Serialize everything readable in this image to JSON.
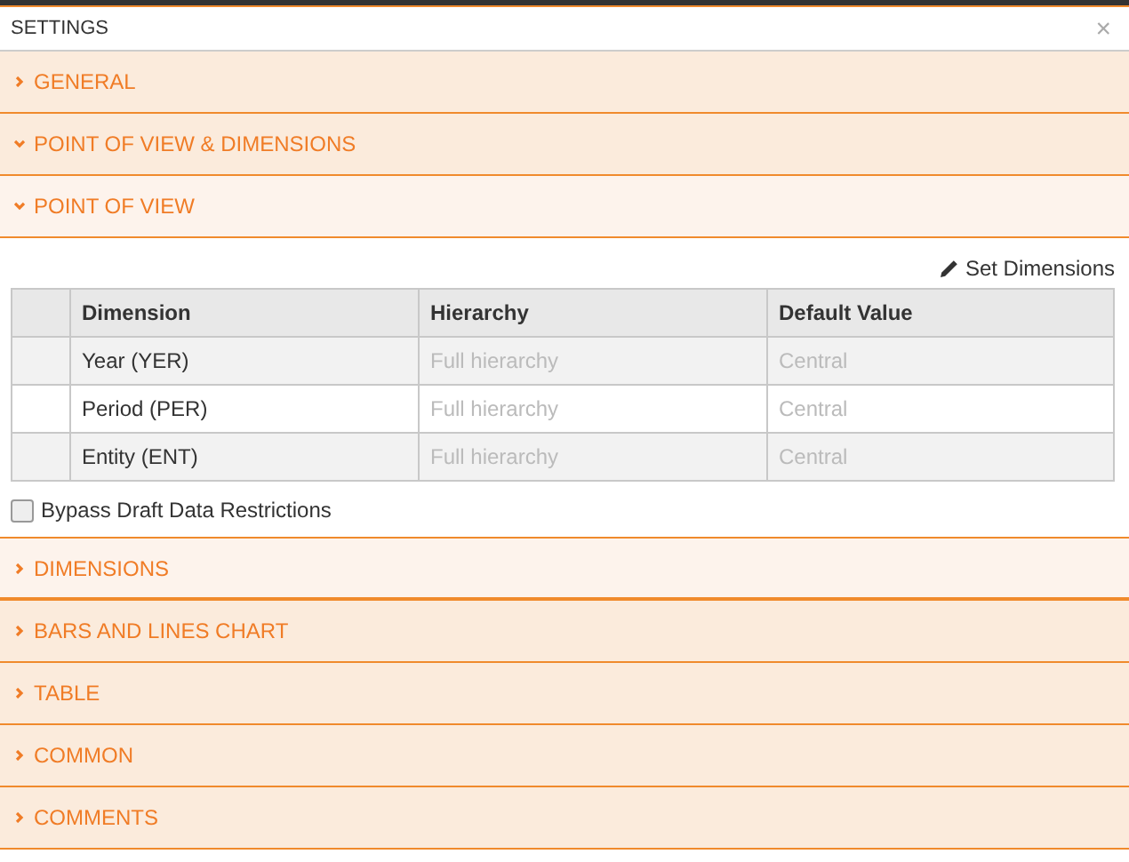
{
  "window": {
    "title": "SETTINGS",
    "close": "×"
  },
  "sections": [
    {
      "label": "GENERAL",
      "expanded": false
    },
    {
      "label": "POINT OF VIEW & DIMENSIONS",
      "expanded": true,
      "children": [
        {
          "label": "POINT OF VIEW",
          "expanded": true,
          "content": {
            "action": "Set Dimensions",
            "columns": [
              "Dimension",
              "Hierarchy",
              "Default Value"
            ],
            "rows": [
              [
                "Year (YER)",
                "Full hierarchy",
                "Central"
              ],
              [
                "Period (PER)",
                "Full hierarchy",
                "Central"
              ],
              [
                "Entity (ENT)",
                "Full hierarchy",
                "Central"
              ]
            ],
            "checkbox": {
              "label": "Bypass Draft Data Restrictions",
              "checked": false
            }
          }
        },
        {
          "label": "DIMENSIONS",
          "expanded": false
        }
      ]
    },
    {
      "label": "BARS AND LINES CHART",
      "expanded": false
    },
    {
      "label": "TABLE",
      "expanded": false
    },
    {
      "label": "COMMON",
      "expanded": false
    },
    {
      "label": "COMMENTS",
      "expanded": false
    }
  ]
}
